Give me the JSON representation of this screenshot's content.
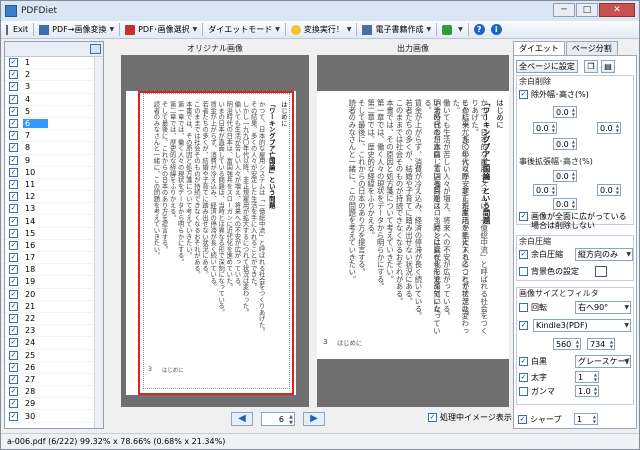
{
  "window": {
    "title": "PDFDiet",
    "min": "─",
    "max": "□",
    "close": "✕"
  },
  "toolbar": {
    "exit": "Exit",
    "pdf_to_image": "PDF→画像変換",
    "pdf_image_select": "PDF･画像選択",
    "diet_mode": "ダイエットモード",
    "run": "変換実行！",
    "ebook": "電子書籍作成",
    "help": "?",
    "info": "i"
  },
  "pagelist": {
    "items": [
      "1",
      "2",
      "3",
      "4",
      "5",
      "6",
      "7",
      "8",
      "9",
      "10",
      "11",
      "12",
      "13",
      "14",
      "15",
      "16",
      "17",
      "18",
      "19",
      "20",
      "21",
      "22",
      "23",
      "24",
      "25",
      "26",
      "27",
      "28",
      "29",
      "30"
    ],
    "selected": "6"
  },
  "views": {
    "original_label": "オリジナル画像",
    "output_label": "出力画像",
    "page_title": "はじめに",
    "page_footer": "はじめに",
    "page_num_mark": "3",
    "heading": "「ワーキングプア亡国論」という問題",
    "body_lines": [
      "かつて、日本的な雇用システムは「一億総中流」と呼ばれる社会をつくりあげた。",
      "その結果、多くの人々が安定した生活を手に入れることができた。",
      "しかし一九九〇年代以降、非正規雇用が拡大するにつれて状況は変わった。",
      "働いても生活が苦しい人々が増え、将来への不安が広がっている。",
      "明治時代の日本は、富国強兵をスローガンに近代化を進めていた。",
      "いまの日本が直面している問題は、当時とは異なる形で深刻になっている。",
      "賃金が上がらず、消費が冷え込み、経済の停滞が長く続いている。",
      "若者たちの多くが、結婚や子育てに踏み出せない状況にある。",
      "このままでは社会そのものが持続できなくなるおそれがある。",
      "本書では、その原因と処方箋について考えていきたい。",
      "第一章では、働く人々の現状をデータから明らかにする。",
      "第二章では、歴史的な経緯をふりかえる。",
      "そして最後に、これからの日本のあり方を提言する。",
      "読者のみなさんと一緒に、この問題を考えていきたい。"
    ],
    "current_page": "6",
    "process_image_label": "処理中イメージ表示"
  },
  "status": {
    "text": "a-006.pdf (6/222)  99.32% x 78.66% (0.68% x 21.34%)"
  },
  "settings": {
    "tabs": [
      "ダイエット",
      "ページ分割"
    ],
    "all_pages_button": "全ページに設定",
    "margin_group": "余白削除",
    "exclude_width_height": "除外幅･高さ(%)",
    "post_width_height": "事後拡張幅･高さ(%)",
    "margin_values": [
      "0.0",
      "0.0",
      "0.0",
      "0.0"
    ],
    "post_values": [
      "0.0",
      "0.0",
      "0.0",
      "0.0"
    ],
    "full_image_note_1": "画像が全面に広がっている",
    "full_image_note_2": "場合は削除しない",
    "compress_group": "余白圧縮",
    "margin_compress": "余白圧縮",
    "margin_compress_mode": "縦方向のみ",
    "bg_color": "背景色の設定",
    "size_group": "画像サイズとフィルタ",
    "rotate": "回転",
    "rotate_value": "右へ90°",
    "device": "Kindle3(PDF)",
    "width_value": "560",
    "height_value": "734",
    "bw": "白黒",
    "bw_mode": "グレースケール",
    "thickness": "太字",
    "thickness_value": "1",
    "gamma": "ガンマ",
    "gamma_value": "1.0",
    "sharpen": "シャープ",
    "sharpen_value": "1"
  }
}
